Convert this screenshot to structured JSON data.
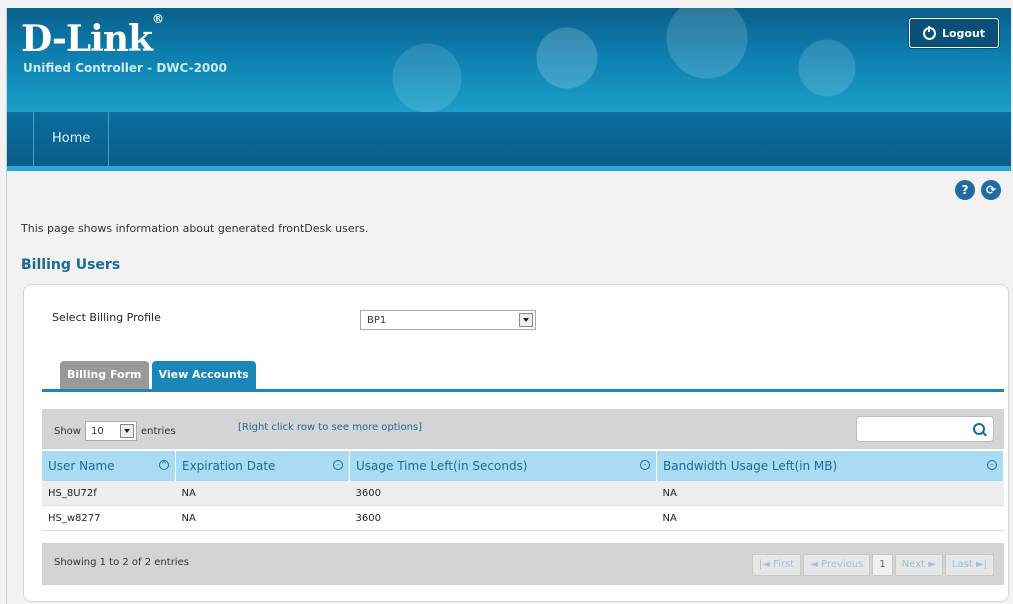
{
  "header": {
    "brand": "D-Link",
    "registered_mark": "®",
    "subtitle": "Unified Controller - DWC-2000",
    "logout_label": "Logout"
  },
  "nav": {
    "home_label": "Home"
  },
  "help_icons": [
    {
      "icon": "help-icon",
      "glyph": "?"
    },
    {
      "icon": "refresh-icon",
      "glyph": "⟳"
    }
  ],
  "page": {
    "description": "This page shows information about generated frontDesk users.",
    "section_title": "Billing Users"
  },
  "billing_profile": {
    "label": "Select Billing Profile",
    "selected": "BP1"
  },
  "tabs": [
    {
      "label": "Billing Form",
      "active": false
    },
    {
      "label": "View Accounts",
      "active": true
    }
  ],
  "toolbar": {
    "show_label": "Show",
    "entries_value": "10",
    "entries_label": "entries",
    "hint": "[Right click row to see more options]",
    "search_placeholder": ""
  },
  "table": {
    "columns": [
      "User Name",
      "Expiration Date",
      "Usage Time Left(in Seconds)",
      "Bandwidth Usage Left(in MB)"
    ],
    "rows": [
      [
        "HS_8U72f",
        "NA",
        "3600",
        "NA"
      ],
      [
        "HS_w8277",
        "NA",
        "3600",
        "NA"
      ]
    ]
  },
  "footer": {
    "showing": "Showing 1 to 2 of 2 entries",
    "first": "First",
    "previous": "Previous",
    "page": "1",
    "next": "Next",
    "last": "Last"
  },
  "colors": {
    "header_blue": "#0d7fb0",
    "accent": "#1b87b9",
    "table_header": "#a9dcf2"
  }
}
